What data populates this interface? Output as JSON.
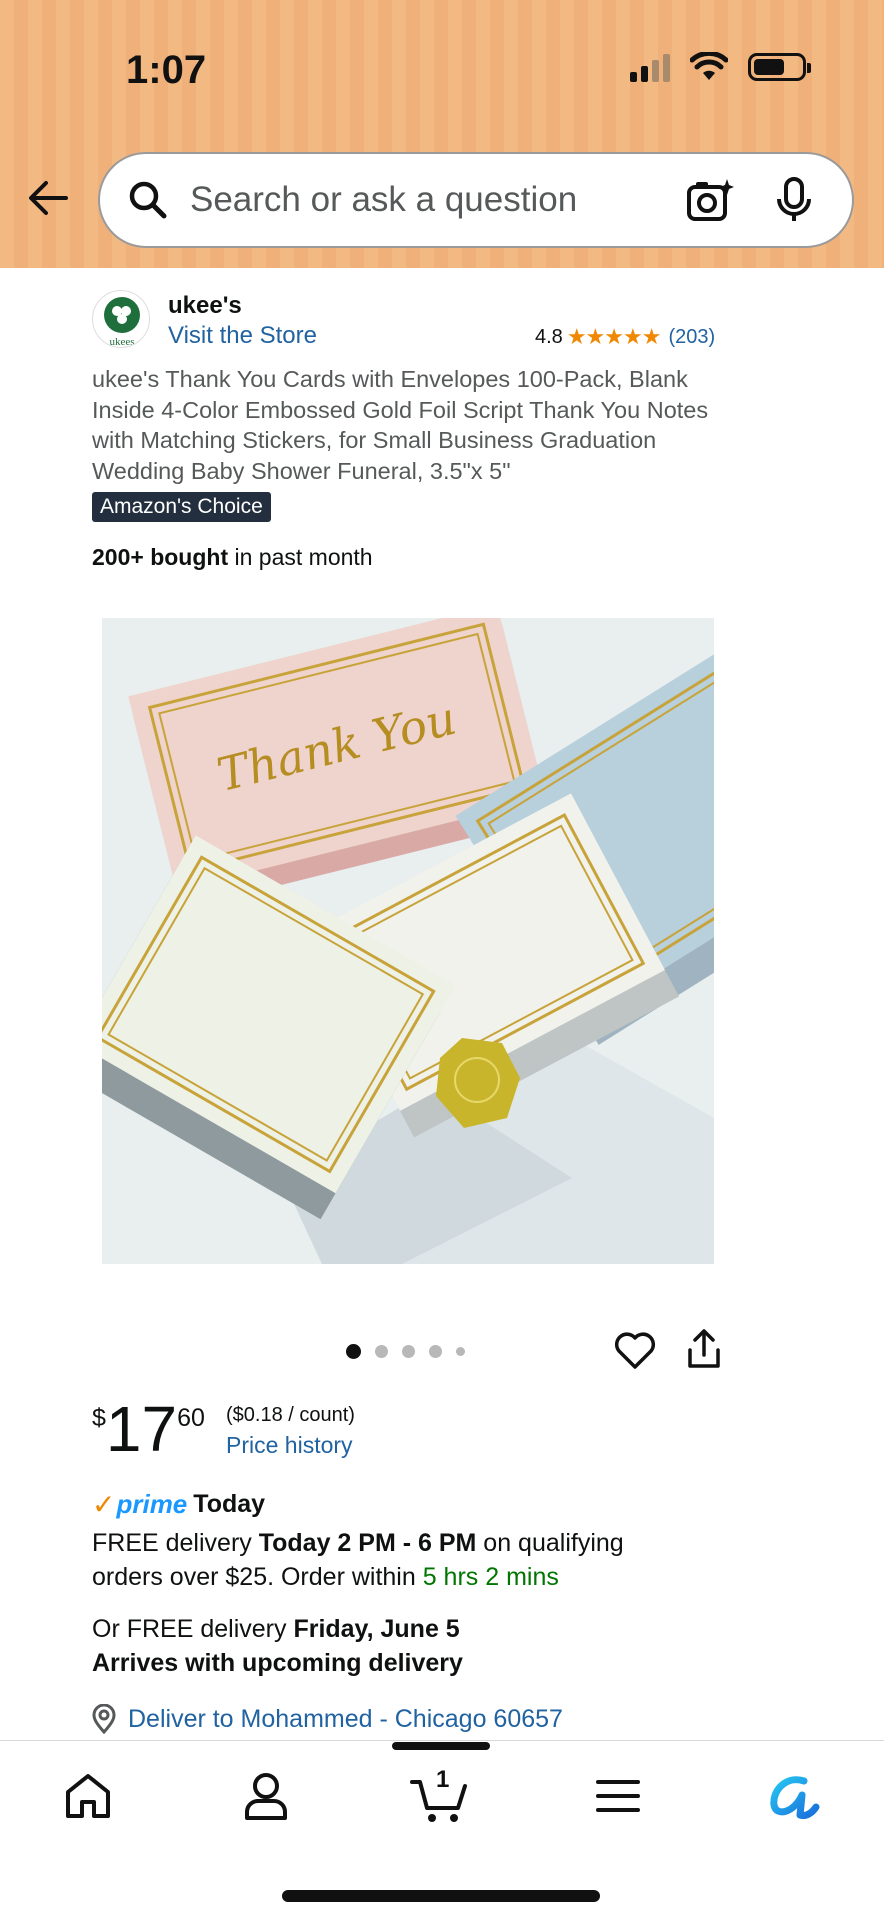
{
  "status_bar": {
    "time": "1:07"
  },
  "search": {
    "placeholder": "Search or ask a question"
  },
  "seller": {
    "name": "ukee's",
    "visit_store": "Visit the Store",
    "logo_text": "ukees"
  },
  "rating": {
    "value": "4.8",
    "stars": "★★★★★",
    "count": "(203)",
    "star_fill": 0.96
  },
  "product": {
    "title": "ukee's Thank You Cards with Envelopes 100-Pack, Blank Inside 4-Color Embossed Gold Foil Script Thank You Notes with Matching Stickers, for Small Business Graduation Wedding Baby Shower Funeral, 3.5\"x 5\"",
    "badge": "Amazon's Choice",
    "bought_bold": "200+ bought",
    "bought_rest": " in past month",
    "image_alt": "Thank You cards in pink, white, blue with gold foil script and gold sticker",
    "image_text": "Thank You"
  },
  "carousel": {
    "count": 5,
    "active_index": 0
  },
  "price": {
    "currency": "$",
    "whole": "17",
    "fraction": "60",
    "unit_price": "($0.18 / count)",
    "price_history": "Price history"
  },
  "delivery": {
    "prime_check": "✓",
    "prime_word": "prime",
    "prime_today": "Today",
    "line1_a": "FREE delivery ",
    "line1_b": "Today 2 PM - 6 PM",
    "line1_c": " on qualifying orders over $25. Order within ",
    "line1_timer": "5 hrs 2 mins",
    "line2_a": "Or FREE delivery ",
    "line2_b": "Friday, June 5",
    "line3": "Arrives with upcoming delivery",
    "deliver_to": "Deliver to Mohammed - Chicago 60657"
  },
  "tabbar": {
    "cart_count": "1"
  },
  "colors": {
    "header": "#f3b983",
    "link": "#2162a1",
    "green": "#007600",
    "star": "#f08804",
    "prime": "#1a98ff"
  }
}
